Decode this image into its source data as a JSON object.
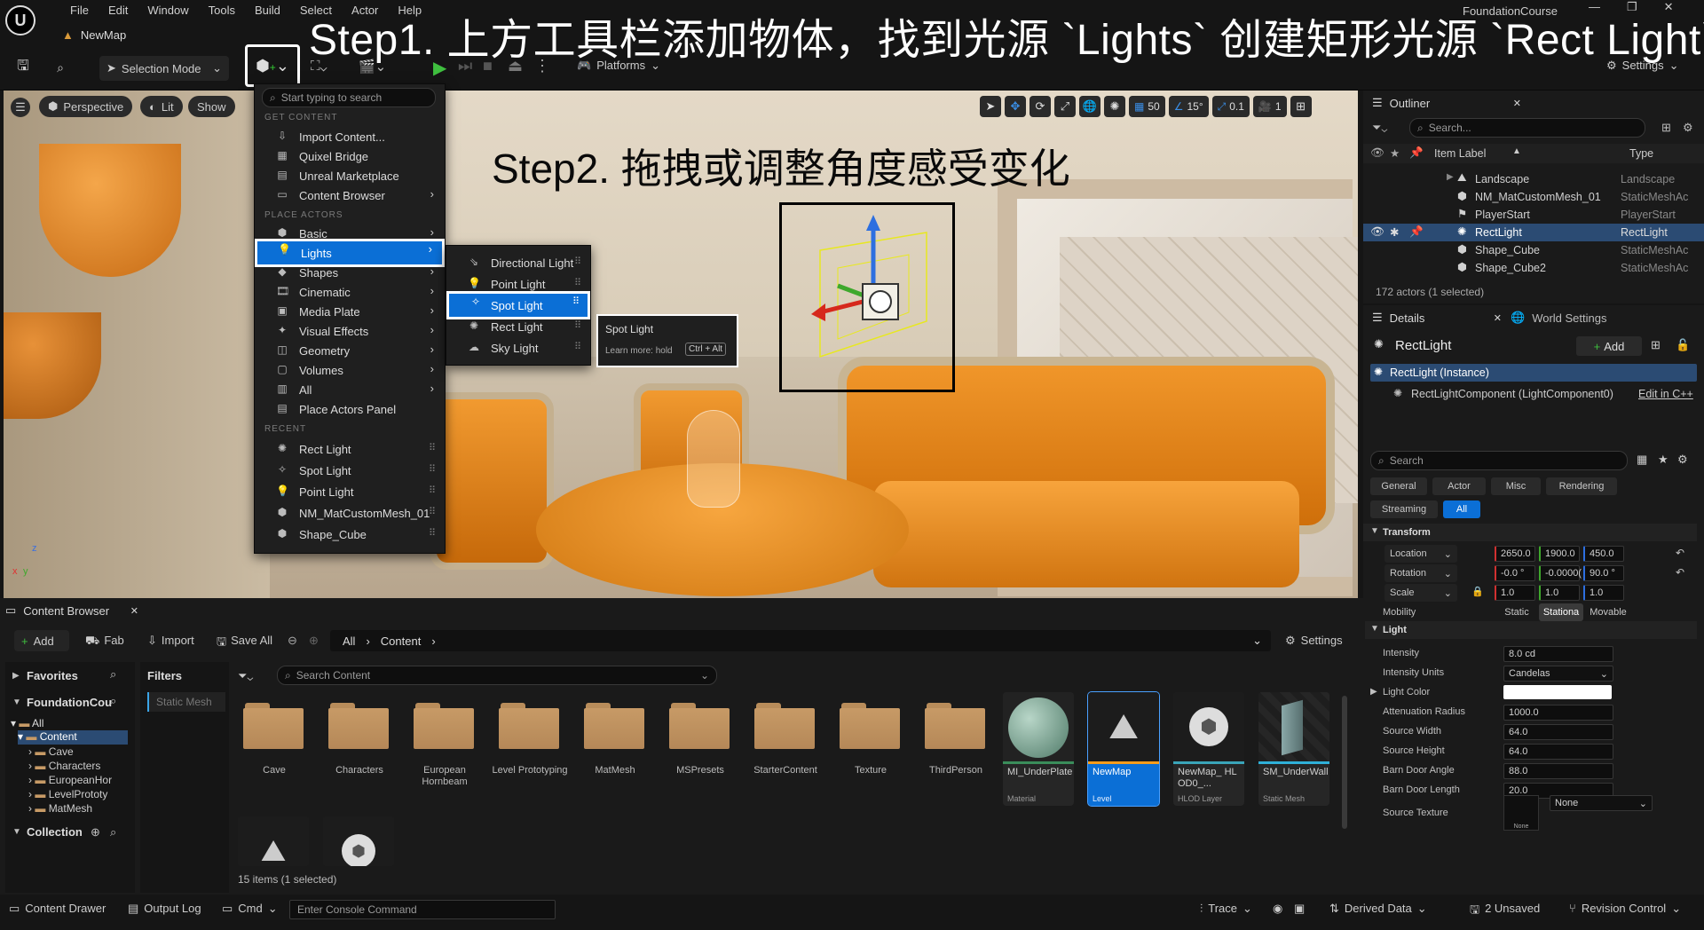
{
  "title_bar": {
    "menus": [
      "File",
      "Edit",
      "Window",
      "Tools",
      "Build",
      "Select",
      "Actor",
      "Help"
    ],
    "project_name": "FoundationCourse",
    "level_tab": "NewMap"
  },
  "toolbar": {
    "selection_mode": "Selection Mode",
    "platforms": "Platforms",
    "settings": "Settings"
  },
  "annotations": {
    "step1": "Step1. 上方工具栏添加物体，找到光源 `Lights` 创建矩形光源 `Rect Light`",
    "step2": "Step2. 拖拽或调整角度感受变化"
  },
  "viewport": {
    "perspective": "Perspective",
    "lit": "Lit",
    "show": "Show",
    "grid_snap": "50",
    "angle_snap": "15°",
    "scale_snap": "0.1",
    "camera_speed": "1"
  },
  "add_menu": {
    "search_placeholder": "Start typing to search",
    "sections": {
      "get_content": "GET CONTENT",
      "place_actors": "PLACE ACTORS",
      "recent": "RECENT"
    },
    "get_content": [
      "Import Content...",
      "Quixel Bridge",
      "Unreal Marketplace",
      "Content Browser"
    ],
    "place_actors": [
      "Basic",
      "Lights",
      "Shapes",
      "Cinematic",
      "Media Plate",
      "Visual Effects",
      "Geometry",
      "Volumes",
      "All",
      "Place Actors Panel"
    ],
    "recent": [
      "Rect Light",
      "Spot Light",
      "Point Light",
      "NM_MatCustomMesh_01",
      "Shape_Cube"
    ]
  },
  "lights_submenu": {
    "items": [
      "Directional Light",
      "Point Light",
      "Spot Light",
      "Rect Light",
      "Sky Light"
    ],
    "selected": "Spot Light"
  },
  "tooltip": {
    "title": "Spot Light",
    "text": "Learn more: hold",
    "shortcut": "Ctrl + Alt"
  },
  "outliner": {
    "tab": "Outliner",
    "search_placeholder": "Search...",
    "col_label": "Item Label",
    "col_type": "Type",
    "rows": [
      {
        "label": "Landscape",
        "type": "Landscape"
      },
      {
        "label": "NM_MatCustomMesh_01",
        "type": "StaticMeshAc"
      },
      {
        "label": "PlayerStart",
        "type": "PlayerStart"
      },
      {
        "label": "RectLight",
        "type": "RectLight"
      },
      {
        "label": "Shape_Cube",
        "type": "StaticMeshAc"
      },
      {
        "label": "Shape_Cube2",
        "type": "StaticMeshAc"
      }
    ],
    "selected_row": "RectLight",
    "footer": "172 actors (1 selected)"
  },
  "details": {
    "tab": "Details",
    "tab2": "World Settings",
    "object_name": "RectLight",
    "add_label": "Add",
    "instance": "RectLight (Instance)",
    "component": "RectLightComponent (LightComponent0)",
    "edit_cpp": "Edit in C++",
    "search_placeholder": "Search",
    "filters": [
      "General",
      "Actor",
      "Misc",
      "Rendering",
      "Streaming",
      "All"
    ],
    "transform_header": "Transform",
    "location_label": "Location",
    "location": [
      "2650.0",
      "1900.0",
      "450.0"
    ],
    "rotation_label": "Rotation",
    "rotation": [
      "-0.0 °",
      "-0.0000(",
      "90.0 °"
    ],
    "scale_label": "Scale",
    "scale": [
      "1.0",
      "1.0",
      "1.0"
    ],
    "mobility_label": "Mobility",
    "mobility": [
      "Static",
      "Stationa",
      "Movable"
    ],
    "light_header": "Light",
    "intensity_label": "Intensity",
    "intensity": "8.0 cd",
    "intensity_units_label": "Intensity Units",
    "intensity_units": "Candelas",
    "light_color_label": "Light Color",
    "attenuation_label": "Attenuation Radius",
    "attenuation": "1000.0",
    "source_width_label": "Source Width",
    "source_width": "64.0",
    "source_height_label": "Source Height",
    "source_height": "64.0",
    "barn_angle_label": "Barn Door Angle",
    "barn_angle": "88.0",
    "barn_length_label": "Barn Door Length",
    "barn_length": "20.0",
    "source_texture_label": "Source Texture",
    "source_texture": "None",
    "source_texture_thumb": "None"
  },
  "content_browser": {
    "tab": "Content Browser",
    "add": "Add",
    "fab": "Fab",
    "import": "Import",
    "save_all": "Save All",
    "path": [
      "All",
      "Content"
    ],
    "settings": "Settings",
    "favorites": "Favorites",
    "root": "FoundationCou",
    "tree": [
      "All",
      "Content",
      "Cave",
      "Characters",
      "EuropeanHor",
      "LevelPrototy",
      "MatMesh"
    ],
    "collection": "Collection",
    "filters": "Filters",
    "filter_chip": "Static Mesh",
    "search_placeholder": "Search Content",
    "folders": [
      "Cave",
      "Characters",
      "European Hornbeam",
      "Level Prototyping",
      "MatMesh",
      "MSPresets",
      "StarterContent",
      "Texture",
      "ThirdPerson"
    ],
    "assets": [
      {
        "name": "MI_UnderPlate",
        "type": "Material"
      },
      {
        "name": "NewMap",
        "type": "Level"
      },
      {
        "name": "NewMap_ HLOD0_...",
        "type": "HLOD Layer"
      },
      {
        "name": "SM_UnderWall",
        "type": "Static Mesh"
      }
    ],
    "footer": "15 items (1 selected)"
  },
  "statusbar": {
    "content_drawer": "Content Drawer",
    "output_log": "Output Log",
    "cmd": "Cmd",
    "console_placeholder": "Enter Console Command",
    "trace": "Trace",
    "derived_data": "Derived Data",
    "unsaved": "2 Unsaved",
    "revision": "Revision Control"
  },
  "colors": {
    "accent": "#0b6fd6",
    "background": "#151515",
    "panel": "#1a1a1a",
    "folder": "#c79a66"
  }
}
